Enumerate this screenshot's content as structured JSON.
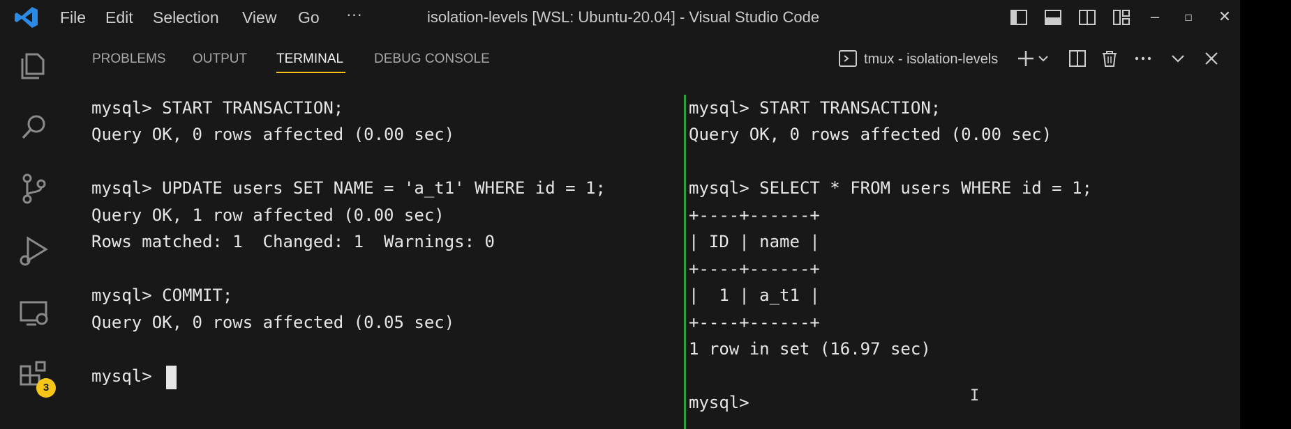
{
  "window": {
    "title": "isolation-levels [WSL: Ubuntu-20.04] - Visual Studio Code",
    "menu": [
      "File",
      "Edit",
      "Selection",
      "View",
      "Go",
      "···"
    ]
  },
  "activity_bar": {
    "items": [
      "explorer-icon",
      "search-icon",
      "source-control-icon",
      "run-debug-icon",
      "remote-explorer-icon",
      "extensions-icon"
    ],
    "extensions_badge": "3"
  },
  "panel": {
    "tabs": [
      "PROBLEMS",
      "OUTPUT",
      "TERMINAL",
      "DEBUG CONSOLE"
    ],
    "active_tab": "TERMINAL",
    "terminal_name": "tmux - isolation-levels"
  },
  "terminal": {
    "left_pane": [
      "mysql> START TRANSACTION;",
      "Query OK, 0 rows affected (0.00 sec)",
      "",
      "mysql> UPDATE users SET NAME = 'a_t1' WHERE id = 1;",
      "Query OK, 1 row affected (0.00 sec)",
      "Rows matched: 1  Changed: 1  Warnings: 0",
      "",
      "mysql> COMMIT;",
      "Query OK, 0 rows affected (0.05 sec)",
      "",
      "mysql> "
    ],
    "right_pane": [
      "mysql> START TRANSACTION;",
      "Query OK, 0 rows affected (0.00 sec)",
      "",
      "mysql> SELECT * FROM users WHERE id = 1;",
      "+----+------+",
      "| ID | name |",
      "+----+------+",
      "|  1 | a_t1 |",
      "+----+------+",
      "1 row in set (16.97 sec)",
      "",
      "mysql>"
    ]
  },
  "colors": {
    "accent": "#f5c518",
    "split_border": "#2ea043",
    "background": "#181818",
    "vscode_blue": "#2a8ae6"
  }
}
